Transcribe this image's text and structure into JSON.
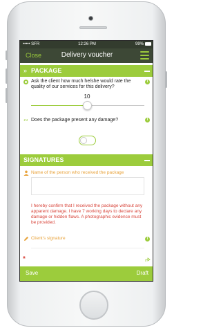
{
  "status_bar": {
    "carrier": "SFR",
    "time": "12:26 PM",
    "battery": "99%"
  },
  "nav": {
    "close_label": "Close",
    "title": "Delivery voucher"
  },
  "package_section": {
    "title": "PACKAGE",
    "chevron": "»",
    "rating_question": "Ask the client how much he/she would rate the quality of our services for this delivery?",
    "rating_value": "10",
    "rating_fraction": 0.5,
    "damage_question": "Does the package present any damage?",
    "damage_toggle_on": false
  },
  "signatures_section": {
    "title": "SIGNATURES",
    "receiver_placeholder": "Name of the person who received the package",
    "confirmation_text": "I hereby confirm that I received the package without any apparent damage. I have 7 working days to declare any damage or hidden flaws. A photographic evidence must be provided.",
    "client_signature_label": "Client's signature",
    "required_mark": "*"
  },
  "bottom_bar": {
    "save_label": "Save",
    "draft_label": "Draft"
  },
  "colors": {
    "accent": "#9ccc3c",
    "nav_background": "#3d4836",
    "warning_text": "#d8453b",
    "placeholder_text": "#e8a23a"
  }
}
